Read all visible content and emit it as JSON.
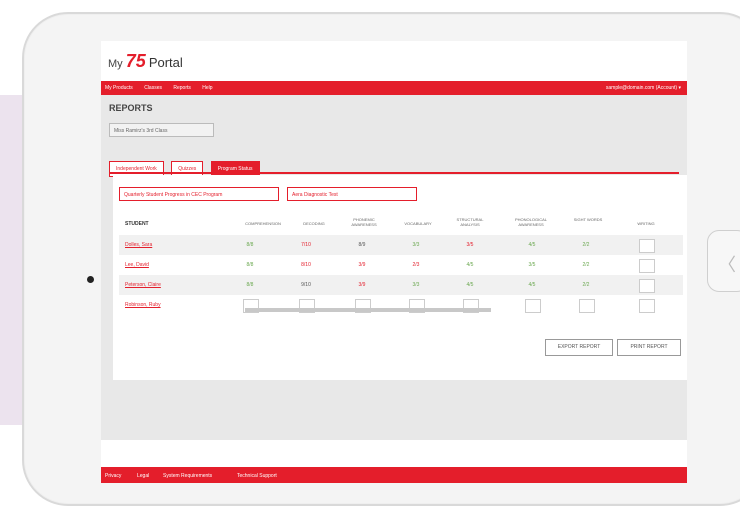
{
  "app": {
    "logo_prefix": "My",
    "logo_brand": "75",
    "logo_name": "Portal"
  },
  "nav": {
    "items": [
      "My Products",
      "Classes",
      "Reports",
      "Help"
    ],
    "user": "sample@domain.com (Account) ▾"
  },
  "reports": {
    "title": "REPORTS",
    "class_select": "Miss Ramirz's 3rd Class",
    "tabs": [
      "Independent Work",
      "Quizzes",
      "Program Status"
    ],
    "filter_1": "Quarterly Student Progress in CEC Program",
    "filter_2": "Aera Diagnostic Test",
    "columns": [
      "STUDENT",
      "COMPREHENSION",
      "DECODING",
      "PHONEMIC AWARENESS",
      "VOCABULARY",
      "STRUCTURAL ANALYSIS",
      "PHONOLOGICAL AWARENESS",
      "SIGHT WORDS",
      "WRITING"
    ],
    "rows": [
      {
        "student": "Dolles, Sara",
        "values": [
          "8/8",
          "7/10",
          "8/9",
          "3/3",
          "3/5",
          "4/5",
          "2/2"
        ],
        "colors": [
          "g",
          "r",
          "k",
          "g",
          "r",
          "g",
          "g"
        ]
      },
      {
        "student": "Lee, David",
        "values": [
          "8/8",
          "8/10",
          "3/9",
          "2/3",
          "4/5",
          "3/5",
          "2/2"
        ],
        "colors": [
          "g",
          "r",
          "r",
          "r",
          "g",
          "g",
          "g"
        ]
      },
      {
        "student": "Peterson, Claire",
        "values": [
          "8/8",
          "9/10",
          "3/9",
          "3/3",
          "4/5",
          "4/5",
          "2/2"
        ],
        "colors": [
          "g",
          "k",
          "r",
          "g",
          "g",
          "g",
          "g"
        ]
      },
      {
        "student": "Robinson, Ruby",
        "values": [
          "",
          "",
          "",
          "",
          "",
          "",
          ""
        ],
        "colors": [
          "k",
          "k",
          "k",
          "k",
          "k",
          "k",
          "k"
        ]
      }
    ],
    "export_label": "EXPORT REPORT",
    "print_label": "PRINT REPORT"
  },
  "footer": {
    "links": [
      "Privacy",
      "Legal",
      "System Requirements",
      "Technical Support"
    ]
  },
  "colors": {
    "brand": "#e41e2b",
    "good": "#6aa84f"
  }
}
